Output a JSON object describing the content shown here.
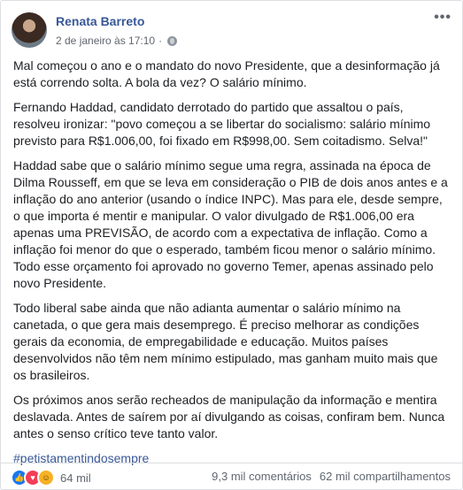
{
  "post": {
    "author": "Renata Barreto",
    "timestamp": "2 de janeiro às 17:10",
    "privacy_icon": "globe-icon",
    "menu_label": "•••",
    "paragraphs": [
      "Mal começou o ano e o mandato do novo Presidente, que a desinformação já está correndo solta. A bola da vez? O salário mínimo.",
      "Fernando Haddad, candidato derrotado do partido que assaltou o país, resolveu ironizar: \"povo começou a se libertar do socialismo: salário mínimo previsto para R$1.006,00, foi fixado em R$998,00. Sem coitadismo. Selva!\"",
      "Haddad sabe que o salário mínimo segue uma regra, assinada na época de Dilma Rousseff, em que se leva em consideração o PIB de dois anos antes e a inflação do ano anterior (usando o índice INPC). Mas para ele, desde sempre, o que importa é mentir e manipular. O valor divulgado de R$1.006,00 era apenas uma PREVISÃO, de acordo com a expectativa de inflação. Como a inflação foi menor do que o esperado, também ficou menor o salário mínimo. Todo esse orçamento foi aprovado no governo Temer, apenas assinado pelo novo Presidente.",
      "Todo liberal sabe ainda que não adianta aumentar o salário mínimo na canetada, o que gera mais desemprego. É preciso melhorar as condições gerais da economia, de empregabilidade e educação. Muitos países desenvolvidos não têm nem mínimo estipulado, mas ganham muito mais que os brasileiros.",
      "Os próximos anos serão recheados de manipulação da informação e mentira deslavada. Antes de saírem por aí divulgando as coisas, confiram bem. Nunca antes o senso crítico teve tanto valor."
    ],
    "hashtag": "#petistamentindosempre",
    "reactions": {
      "icons": [
        "like-icon",
        "love-icon",
        "haha-icon"
      ],
      "count": "64 mil"
    },
    "comments": "9,3 mil comentários",
    "shares": "62 mil compartilhamentos"
  }
}
